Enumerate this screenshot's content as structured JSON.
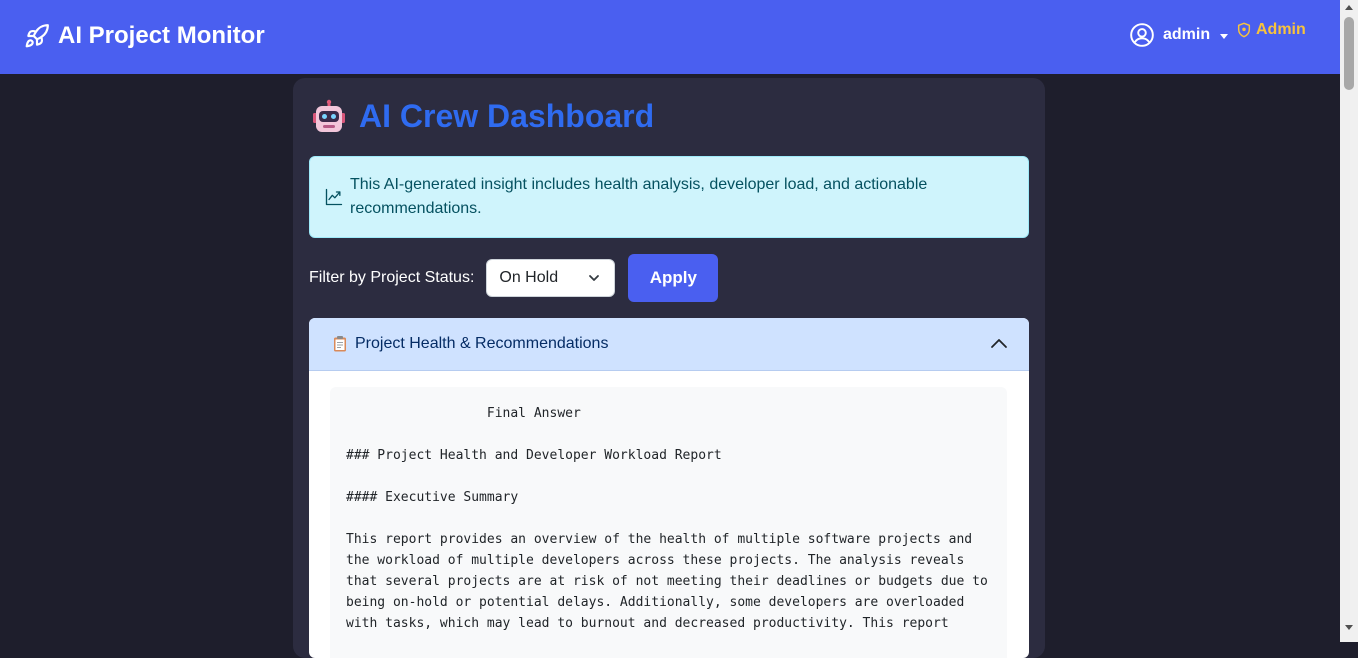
{
  "navbar": {
    "brand": "AI Project Monitor",
    "brand_icon": "rocket-icon",
    "user_name": "admin",
    "admin_link": "Admin",
    "admin_color": "#f7c33d",
    "bg_color": "#4a5ff0"
  },
  "dashboard": {
    "title": "AI Crew Dashboard",
    "title_color": "#2f6bf0"
  },
  "alert": {
    "text": "This AI-generated insight includes health analysis, developer load, and actionable recommendations."
  },
  "filter": {
    "label": "Filter by Project Status:",
    "selected": "On Hold",
    "apply_label": "Apply"
  },
  "accordion": {
    "title": "Project Health & Recommendations",
    "report_lines": [
      "                  Final Answer",
      "",
      "### Project Health and Developer Workload Report",
      "",
      "#### Executive Summary",
      "",
      "This report provides an overview of the health of multiple software projects and",
      "the workload of multiple developers across these projects. The analysis reveals",
      "that several projects are at risk of not meeting their deadlines or budgets due to",
      "being on-hold or potential delays. Additionally, some developers are overloaded",
      "with tasks, which may lead to burnout and decreased productivity. This report"
    ]
  }
}
